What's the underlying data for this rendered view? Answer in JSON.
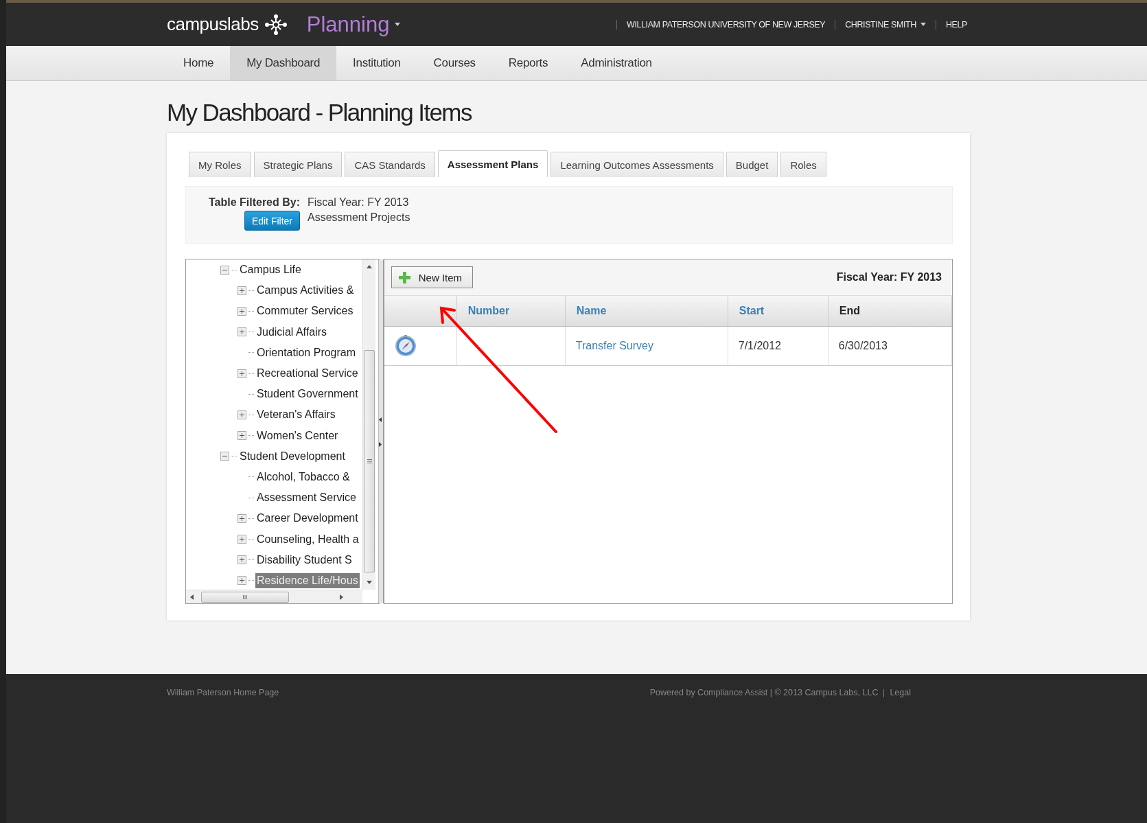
{
  "header": {
    "logo": "campuslabs",
    "product": "Planning",
    "institution": "WILLIAM PATERSON UNIVERSITY OF NEW JERSEY",
    "user": "CHRISTINE SMITH",
    "help": "HELP"
  },
  "nav": [
    {
      "label": "Home",
      "selected": false
    },
    {
      "label": "My Dashboard",
      "selected": true
    },
    {
      "label": "Institution",
      "selected": false
    },
    {
      "label": "Courses",
      "selected": false
    },
    {
      "label": "Reports",
      "selected": false
    },
    {
      "label": "Administration",
      "selected": false
    }
  ],
  "page_title": "My Dashboard - Planning Items",
  "tabs": [
    {
      "label": "My Roles",
      "selected": false
    },
    {
      "label": "Strategic Plans",
      "selected": false
    },
    {
      "label": "CAS Standards",
      "selected": false
    },
    {
      "label": "Assessment Plans",
      "selected": true
    },
    {
      "label": "Learning Outcomes Assessments",
      "selected": false
    },
    {
      "label": "Budget",
      "selected": false
    },
    {
      "label": "Roles",
      "selected": false
    }
  ],
  "filter": {
    "label": "Table Filtered By:",
    "button": "Edit Filter",
    "values": [
      "Fiscal Year: FY 2013",
      "Assessment Projects"
    ]
  },
  "tree": [
    {
      "label": "Campus Life",
      "kind": "expanded",
      "selected": false,
      "children": [
        {
          "label": "Campus Activities &",
          "kind": "collapsed",
          "selected": false
        },
        {
          "label": "Commuter Services",
          "kind": "collapsed",
          "selected": false
        },
        {
          "label": "Judicial Affairs",
          "kind": "collapsed",
          "selected": false
        },
        {
          "label": "Orientation Program",
          "kind": "leaf",
          "selected": false
        },
        {
          "label": "Recreational Service",
          "kind": "collapsed",
          "selected": false
        },
        {
          "label": "Student Government",
          "kind": "leaf",
          "selected": false
        },
        {
          "label": "Veteran's Affairs",
          "kind": "collapsed",
          "selected": false
        },
        {
          "label": "Women's Center",
          "kind": "collapsed",
          "selected": false
        }
      ]
    },
    {
      "label": "Student Development",
      "kind": "expanded",
      "selected": false,
      "children": [
        {
          "label": "Alcohol, Tobacco &",
          "kind": "leaf",
          "selected": false
        },
        {
          "label": "Assessment Service",
          "kind": "leaf",
          "selected": false
        },
        {
          "label": "Career Development",
          "kind": "collapsed",
          "selected": false
        },
        {
          "label": "Counseling, Health a",
          "kind": "collapsed",
          "selected": false
        },
        {
          "label": "Disability Student S",
          "kind": "collapsed",
          "selected": false
        },
        {
          "label": "Residence Life/Hous",
          "kind": "collapsed",
          "selected": true
        }
      ]
    }
  ],
  "grid": {
    "new_button": "New Item",
    "fiscal_year": "Fiscal Year: FY 2013",
    "columns": [
      {
        "label": "Number",
        "sortable": true
      },
      {
        "label": "Name",
        "sortable": true
      },
      {
        "label": "Start",
        "sortable": true
      },
      {
        "label": "End",
        "sortable": false
      }
    ],
    "rows": [
      {
        "kind": "compass",
        "number": "",
        "name": "Transfer Survey",
        "start": "7/1/2012",
        "end": "6/30/2013"
      }
    ]
  },
  "footer": {
    "home_link": "William Paterson Home Page",
    "credit": "Powered by Compliance Assist | © 2013 Campus Labs, LLC",
    "legal": "Legal"
  }
}
